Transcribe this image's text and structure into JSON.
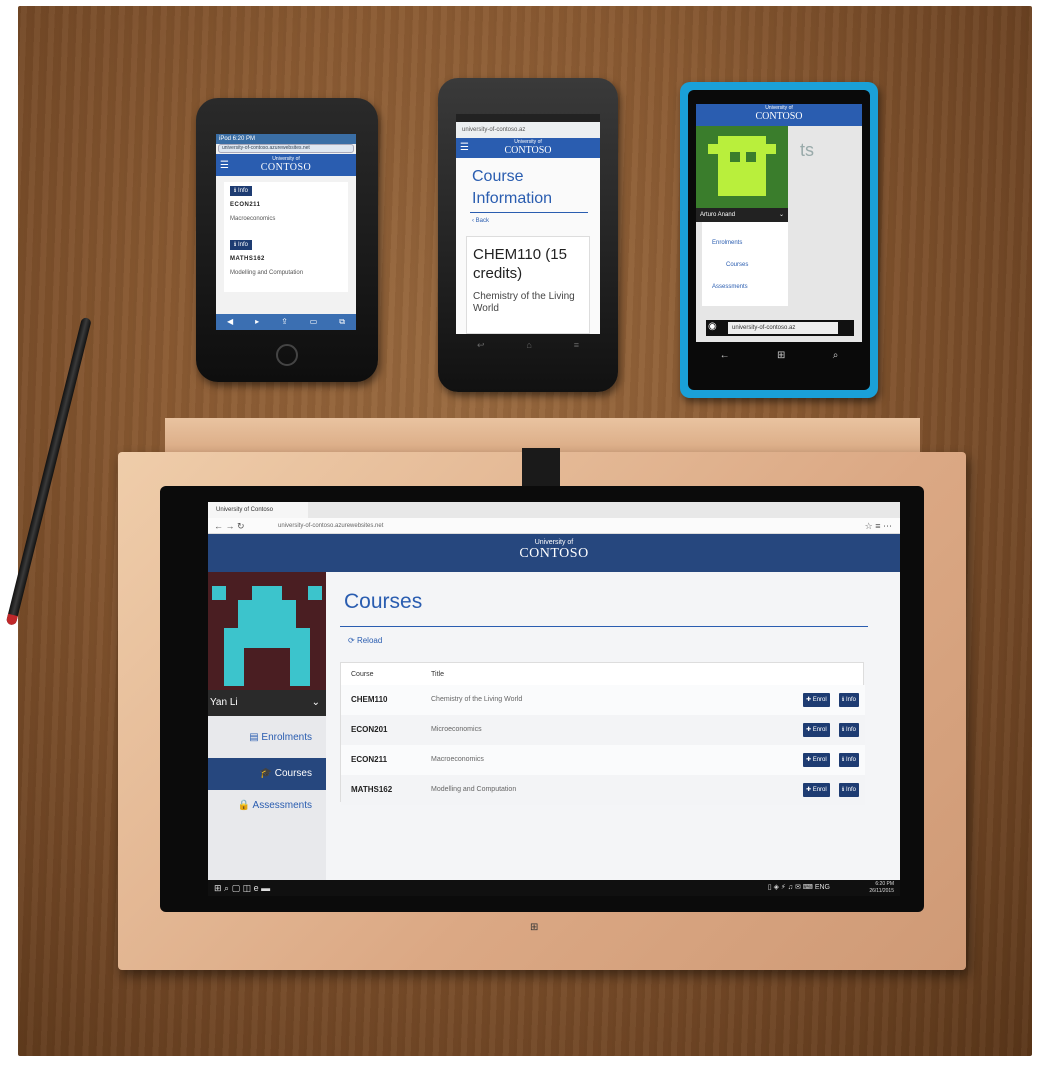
{
  "iphone": {
    "status": "iPod  6:20 PM",
    "url": "university-of-contoso.azurewebsites.net",
    "header_small": "University of",
    "header_brand": "CONTOSO",
    "items": [
      {
        "button": "ℹ Info",
        "code": "ECON211",
        "title": "Macroeconomics"
      },
      {
        "button": "ℹ Info",
        "code": "MATHS162",
        "title": "Modelling and Computation"
      }
    ]
  },
  "android": {
    "url": "university-of-contoso.az",
    "header_small": "University of",
    "header_brand": "CONTOSO",
    "page_title": "Course Information",
    "back": "‹ Back",
    "course_code": "CHEM110 (15 credits)",
    "course_title": "Chemistry of the Living World"
  },
  "wphone": {
    "header_small": "University of",
    "header_brand": "CONTOSO",
    "bg_text": "ts",
    "user": "Arturo Anand",
    "nav": [
      "Enrolments",
      "Courses",
      "Assessments"
    ],
    "address": "university-of-contoso.az"
  },
  "tablet": {
    "tab_title": "University of Contoso",
    "url": "university-of-contoso.azurewebsites.net",
    "header_small": "University of",
    "header_brand": "CONTOSO",
    "user": "Yan Li",
    "nav": [
      "Enrolments",
      "Courses",
      "Assessments"
    ],
    "active_nav": "Courses",
    "page_title": "Courses",
    "reload": "Reload",
    "columns": [
      "Course",
      "Title"
    ],
    "rows": [
      {
        "code": "CHEM110",
        "title": "Chemistry of the Living World",
        "enrol": "Enrol",
        "info": "Info"
      },
      {
        "code": "ECON201",
        "title": "Microeconomics",
        "enrol": "Enrol",
        "info": "Info"
      },
      {
        "code": "ECON211",
        "title": "Macroeconomics",
        "enrol": "Enrol",
        "info": "Info"
      },
      {
        "code": "MATHS162",
        "title": "Modelling and Computation",
        "enrol": "Enrol",
        "info": "Info"
      }
    ],
    "clock_time": "6:20 PM",
    "clock_date": "26/11/2015",
    "tray_lang": "ENG"
  }
}
